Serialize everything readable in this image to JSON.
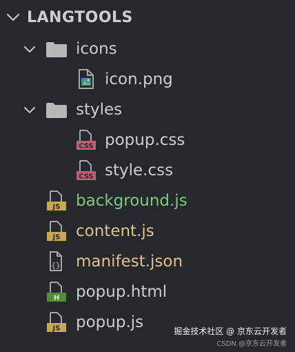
{
  "header": {
    "title": "LANGTOOLS"
  },
  "tree": {
    "folder_icons": {
      "label": "icons",
      "color": "#cdcdcd"
    },
    "file_icon_png": {
      "label": "icon.png",
      "color": "#cdcdcd"
    },
    "folder_styles": {
      "label": "styles",
      "color": "#cdcdcd"
    },
    "file_popup_css": {
      "label": "popup.css",
      "badge": "CSS",
      "color": "#cdcdcd",
      "badge_color": "#c85a78"
    },
    "file_style_css": {
      "label": "style.css",
      "badge": "CSS",
      "color": "#cdcdcd",
      "badge_color": "#c85a78"
    },
    "file_background_js": {
      "label": "background.js",
      "badge": "JS",
      "color": "#81c784",
      "badge_color": "#c8a84e"
    },
    "file_content_js": {
      "label": "content.js",
      "badge": "JS",
      "color": "#e2c08d",
      "badge_color": "#c8a84e"
    },
    "file_manifest_json": {
      "label": "manifest.json",
      "badge": "{}",
      "color": "#e2c08d",
      "badge_color": "#9a9a9a"
    },
    "file_popup_html": {
      "label": "popup.html",
      "badge": "H",
      "color": "#cdcdcd",
      "badge_color": "#4e8f3a"
    },
    "file_popup_js": {
      "label": "popup.js",
      "badge": "JS",
      "color": "#cdcdcd",
      "badge_color": "#c8a84e"
    }
  },
  "watermark": {
    "line1": "掘金技术社区 @ 京东云开发者",
    "line2": "CSDN @京东云开发者"
  }
}
